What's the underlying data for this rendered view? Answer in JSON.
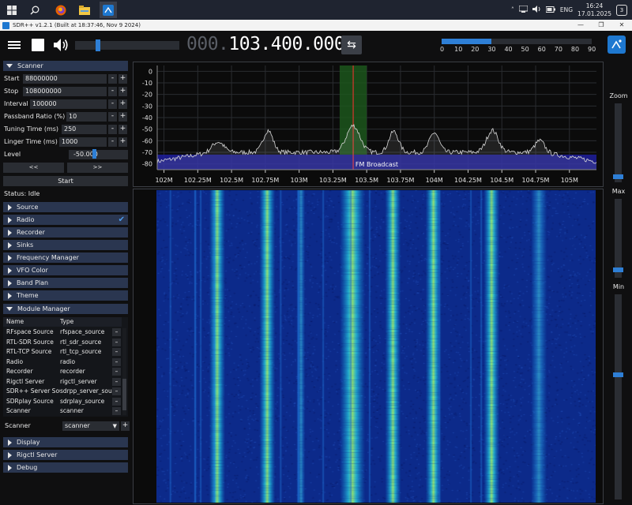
{
  "taskbar": {
    "clock_time": "16:24",
    "clock_date": "17.01.2025",
    "language": "ENG",
    "notifications": "3",
    "tray_chevron": "˄"
  },
  "window": {
    "title": "SDR++ v1.2.1 (Built at 18:37:46, Nov  9 2024)",
    "minimize": "—",
    "maximize": "❐",
    "close": "✕"
  },
  "topbar": {
    "frequency_dim": "000.",
    "frequency_bright": "103.400.000",
    "swap_icon": "⇆",
    "volume_fraction": 0.2,
    "snr_fill_fraction": 0.33,
    "snr_scale": [
      "0",
      "10",
      "20",
      "30",
      "40",
      "50",
      "60",
      "70",
      "80",
      "90"
    ]
  },
  "scanner": {
    "header": "Scanner",
    "start_label": "Start",
    "start_value": "88000000",
    "stop_label": "Stop",
    "stop_value": "108000000",
    "interval_label": "Interval",
    "interval_value": "100000",
    "passband_label": "Passband Ratio (%)",
    "passband_value": "10",
    "tuning_label": "Tuning Time (ms)",
    "tuning_value": "250",
    "linger_label": "Linger Time (ms)",
    "linger_value": "1000",
    "level_label": "Level",
    "level_value": "-50.000",
    "prev_button": "<<",
    "next_button": ">>",
    "start_button": "Start",
    "status": "Status: Idle",
    "minus": "-",
    "plus": "+"
  },
  "menu": {
    "source": "Source",
    "radio": "Radio",
    "recorder": "Recorder",
    "sinks": "Sinks",
    "frequency_manager": "Frequency Manager",
    "vfo_color": "VFO Color",
    "band_plan": "Band Plan",
    "theme": "Theme",
    "module_manager": "Module Manager",
    "display": "Display",
    "rigctl_server": "Rigctl Server",
    "debug": "Debug",
    "check_icon": "✔"
  },
  "module_manager": {
    "col_name": "Name",
    "col_type": "Type",
    "del_label": "–",
    "rows": [
      {
        "name": "RFspace Source",
        "type": "rfspace_source"
      },
      {
        "name": "RTL-SDR Source",
        "type": "rtl_sdr_source"
      },
      {
        "name": "RTL-TCP Source",
        "type": "rtl_tcp_source"
      },
      {
        "name": "Radio",
        "type": "radio"
      },
      {
        "name": "Recorder",
        "type": "recorder"
      },
      {
        "name": "Rigctl Server",
        "type": "rigctl_server"
      },
      {
        "name": "SDR++ Server Sou",
        "type": "sdrpp_server_sou"
      },
      {
        "name": "SDRplay Source",
        "type": "sdrplay_source"
      },
      {
        "name": "Scanner",
        "type": "scanner"
      }
    ],
    "new_name": "Scanner",
    "new_type": "scanner",
    "dropdown_icon": "▼",
    "add_label": "+"
  },
  "right_panel": {
    "zoom_label": "Zoom",
    "max_label": "Max",
    "min_label": "Min",
    "zoom_fraction": 0.05,
    "max_fraction": 0.08,
    "min_fraction": 0.6
  },
  "colors": {
    "accent": "#2e7fd6",
    "band_fill": "#1f1f9e",
    "vfo_fill": "#1d5a1d",
    "vfo_line": "#ff3030",
    "trace": "#d8d8d8"
  },
  "chart_data": {
    "type": "line",
    "ylim": [
      -85,
      5
    ],
    "y_ticks": [
      "0",
      "-10",
      "-20",
      "-30",
      "-40",
      "-50",
      "-60",
      "-70",
      "-80"
    ],
    "y_tick_values": [
      0,
      -10,
      -20,
      -30,
      -40,
      -50,
      -60,
      -70,
      -80
    ],
    "xlim_mhz": [
      101.95,
      105.2
    ],
    "x_ticks": [
      "102M",
      "102.25M",
      "102.5M",
      "102.75M",
      "103M",
      "103.25M",
      "103.5M",
      "103.75M",
      "104M",
      "104.25M",
      "104.5M",
      "104.75M",
      "105M"
    ],
    "x_tick_values": [
      102,
      102.25,
      102.5,
      102.75,
      103,
      103.25,
      103.5,
      103.75,
      104,
      104.25,
      104.5,
      104.75,
      105
    ],
    "band_label": "FM Broadcast",
    "band_range_db": [
      -72,
      -85
    ],
    "vfo_center_mhz": 103.4,
    "vfo_bandwidth_mhz": 0.2,
    "noise_floor_db": -70,
    "peaks": [
      {
        "mhz": 102.4,
        "db": -61,
        "width": 0.06
      },
      {
        "mhz": 102.77,
        "db": -51,
        "width": 0.05
      },
      {
        "mhz": 103.4,
        "db": -47,
        "width": 0.07
      },
      {
        "mhz": 103.7,
        "db": -52,
        "width": 0.05
      },
      {
        "mhz": 104.0,
        "db": -53,
        "width": 0.05
      },
      {
        "mhz": 104.43,
        "db": -51,
        "width": 0.06
      },
      {
        "mhz": 104.78,
        "db": -60,
        "width": 0.05
      }
    ],
    "waterfall_stations_mhz": [
      102.4,
      102.77,
      103.02,
      103.4,
      103.7,
      104.0,
      104.43,
      104.78
    ]
  }
}
